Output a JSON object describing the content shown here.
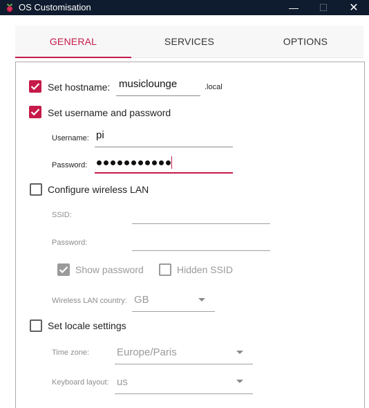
{
  "window": {
    "title": "OS Customisation",
    "minimize_glyph": "—",
    "maximize_glyph": "☐",
    "close_glyph": "✕"
  },
  "tabs": [
    {
      "label": "GENERAL",
      "active": true
    },
    {
      "label": "SERVICES",
      "active": false
    },
    {
      "label": "OPTIONS",
      "active": false
    }
  ],
  "hostname": {
    "label": "Set hostname:",
    "checked": true,
    "value": "musiclounge",
    "suffix": ".local"
  },
  "user": {
    "label": "Set username and password",
    "checked": true,
    "username_label": "Username:",
    "username_value": "pi",
    "password_label": "Password:",
    "password_mask_count": 11
  },
  "wlan": {
    "label": "Configure wireless LAN",
    "checked": false,
    "ssid_label": "SSID:",
    "ssid_value": "",
    "password_label": "Password:",
    "password_value": "",
    "show_password_label": "Show password",
    "show_password_checked": true,
    "hidden_ssid_label": "Hidden SSID",
    "hidden_ssid_checked": false,
    "country_label": "Wireless LAN country:",
    "country_value": "GB"
  },
  "locale": {
    "label": "Set locale settings",
    "checked": false,
    "timezone_label": "Time zone:",
    "timezone_value": "Europe/Paris",
    "keyboard_label": "Keyboard layout:",
    "keyboard_value": "us"
  },
  "colors": {
    "accent": "#c51a4a",
    "titlebar": "#0f1b2e",
    "disabled_text": "#9a9a9a"
  }
}
